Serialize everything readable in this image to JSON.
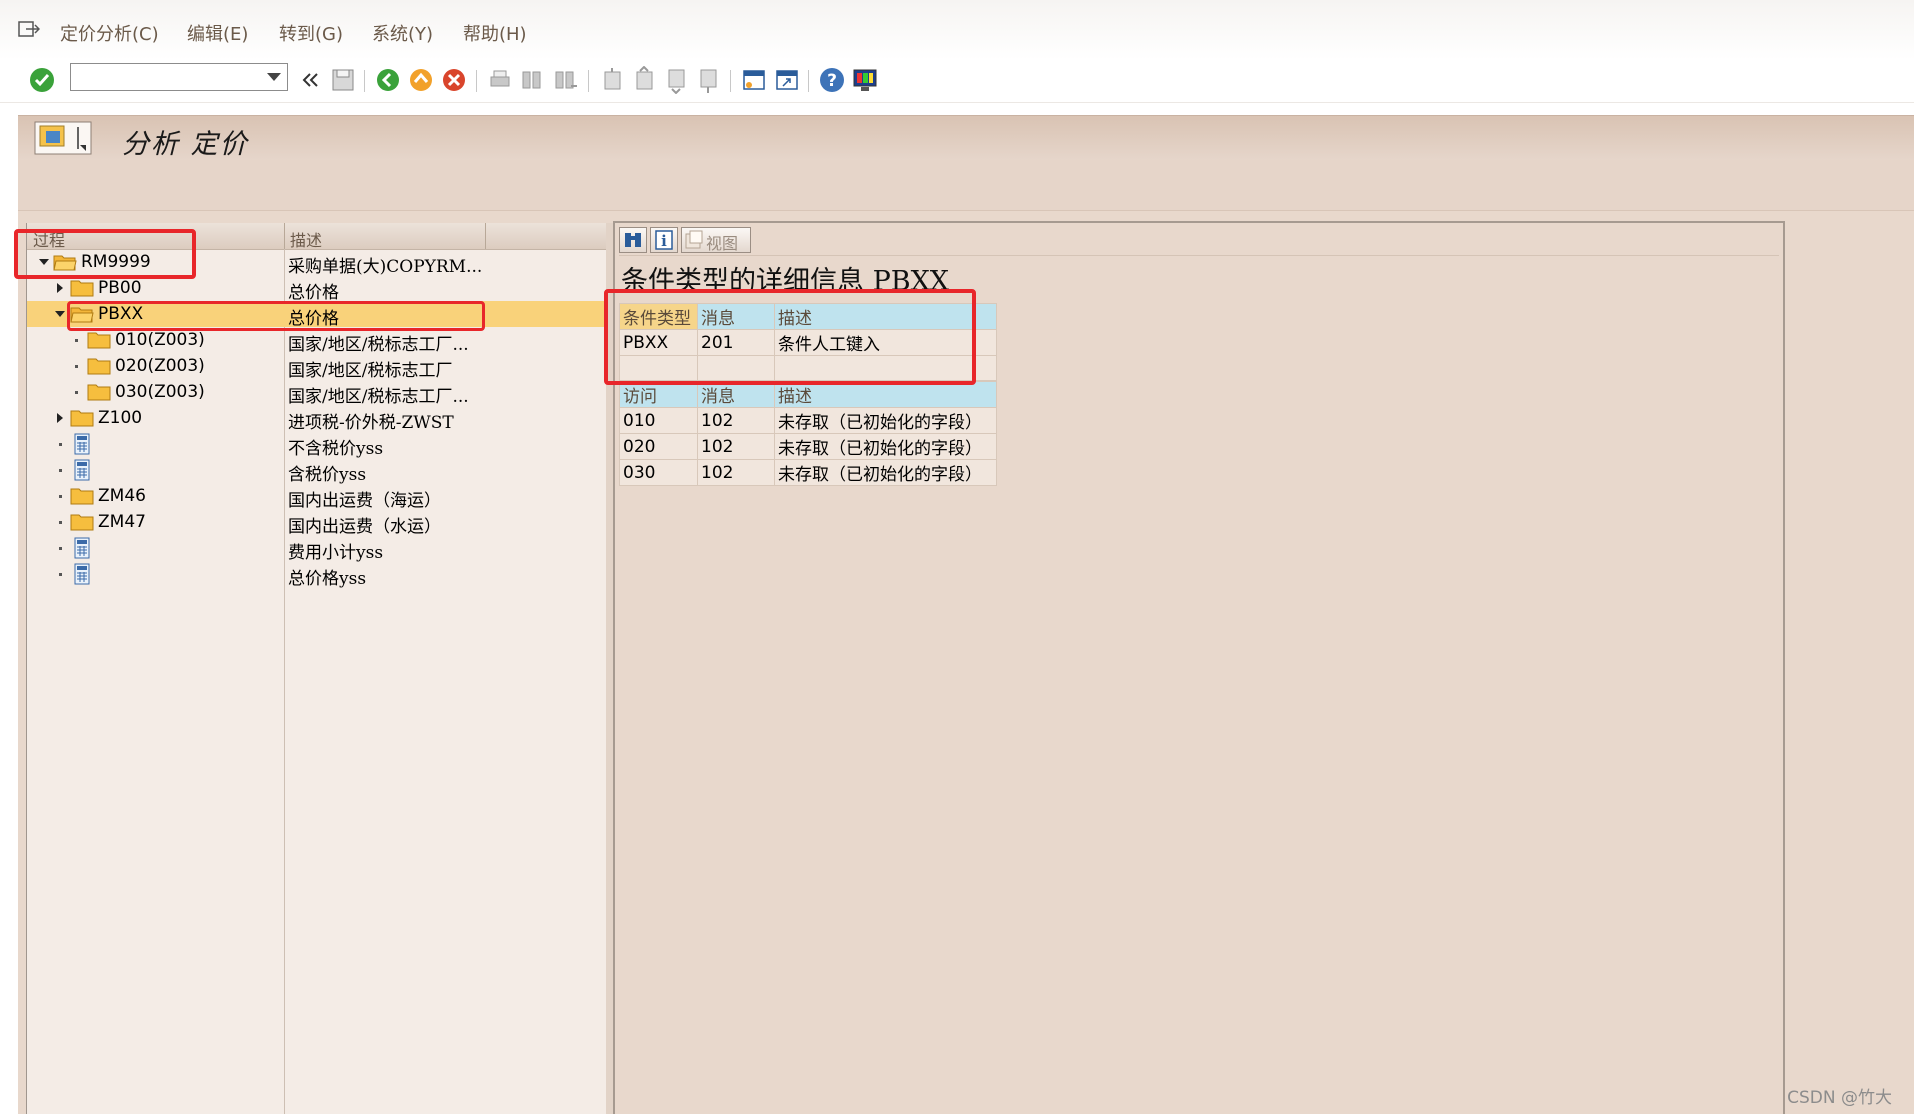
{
  "menubar": {
    "items": [
      "定价分析(C)",
      "编辑(E)",
      "转到(G)",
      "系统(Y)",
      "帮助(H)"
    ]
  },
  "toolbar": {
    "command_value": "",
    "icons": [
      "enter-check-icon",
      "back-double-arrow-icon",
      "save-icon",
      "back-icon",
      "exit-icon",
      "cancel-icon",
      "print-icon",
      "find-icon",
      "find-next-icon",
      "first-page-icon",
      "previous-page-icon",
      "next-page-icon",
      "last-page-icon",
      "create-session-icon",
      "shortcut-icon",
      "help-icon",
      "customize-layout-icon"
    ]
  },
  "title": {
    "text": "分析 定价"
  },
  "tree": {
    "columns": [
      "过程",
      "描述"
    ],
    "rows": [
      {
        "label": "RM9999",
        "desc": "采购单据(大)COPYRM...",
        "level": 0,
        "expander": "down",
        "icon": "open-folder"
      },
      {
        "label": "PB00",
        "desc": "总价格",
        "level": 1,
        "expander": "right",
        "icon": "folder"
      },
      {
        "label": "PBXX",
        "desc": "总价格",
        "level": 1,
        "expander": "down",
        "icon": "open-folder",
        "selected": true
      },
      {
        "label": "010(Z003)",
        "desc": "国家/地区/税标志工厂...",
        "level": 2,
        "expander": "dot",
        "icon": "folder"
      },
      {
        "label": "020(Z003)",
        "desc": "国家/地区/税标志工厂",
        "level": 2,
        "expander": "dot",
        "icon": "folder"
      },
      {
        "label": "030(Z003)",
        "desc": "国家/地区/税标志工厂...",
        "level": 2,
        "expander": "dot",
        "icon": "folder"
      },
      {
        "label": "Z100",
        "desc": "进项税-价外税-ZWST",
        "level": 1,
        "expander": "right",
        "icon": "folder"
      },
      {
        "label": "",
        "desc": "不含税价yss",
        "level": 1,
        "expander": "dot",
        "icon": "calculator"
      },
      {
        "label": "",
        "desc": "含税价yss",
        "level": 1,
        "expander": "dot",
        "icon": "calculator"
      },
      {
        "label": "ZM46",
        "desc": "国内出运费（海运）",
        "level": 1,
        "expander": "dot",
        "icon": "folder"
      },
      {
        "label": "ZM47",
        "desc": "国内出运费（水运）",
        "level": 1,
        "expander": "dot",
        "icon": "folder"
      },
      {
        "label": "",
        "desc": "费用小计yss",
        "level": 1,
        "expander": "dot",
        "icon": "calculator"
      },
      {
        "label": "",
        "desc": "总价格yss",
        "level": 1,
        "expander": "dot",
        "icon": "calculator"
      }
    ]
  },
  "detail": {
    "view_label": "视图",
    "title": "条件类型的详细信息 PBXX",
    "condition_table": {
      "headers": [
        "条件类型",
        "消息",
        "描述"
      ],
      "rows": [
        [
          "PBXX",
          "201",
          "条件人工键入"
        ]
      ]
    },
    "access_table": {
      "headers": [
        "访问",
        "消息",
        "描述"
      ],
      "rows": [
        [
          "010",
          "102",
          "未存取（已初始化的字段）"
        ],
        [
          "020",
          "102",
          "未存取（已初始化的字段）"
        ],
        [
          "030",
          "102",
          "未存取（已初始化的字段）"
        ]
      ]
    }
  },
  "watermark": "CSDN @竹大",
  "colors": {
    "title_bar": "#d9c3b3",
    "selected_row": "#f9d27a",
    "table_header": "#bfe3ee",
    "highlight_box": "#e8262a"
  }
}
